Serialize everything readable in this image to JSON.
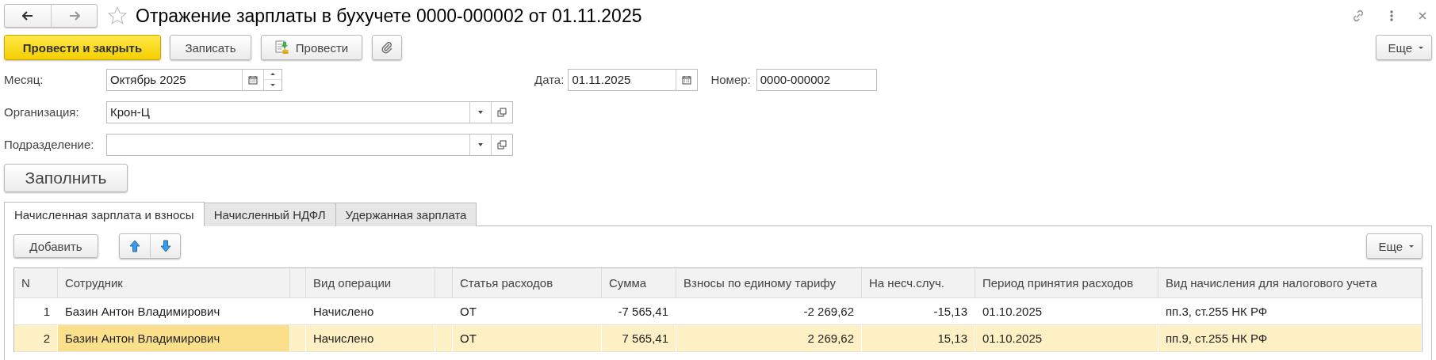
{
  "window": {
    "title": "Отражение зарплаты в бухучете 0000-000002 от 01.11.2025",
    "favorite": false
  },
  "command_bar": {
    "buttons": [
      {
        "label": "Провести и закрыть",
        "kind": "primary"
      },
      {
        "label": "Записать",
        "kind": "plain"
      },
      {
        "label": "Провести",
        "kind": "post"
      },
      {
        "kind": "attach"
      }
    ],
    "more": "Еще"
  },
  "fields": {
    "month": {
      "label": "Месяц:",
      "value": "Октябрь 2025"
    },
    "date": {
      "label": "Дата:",
      "value": "01.11.2025"
    },
    "number": {
      "label": "Номер:",
      "value": "0000-000002"
    },
    "organization": {
      "label": "Организация:",
      "value": "Крон-Ц"
    },
    "division": {
      "label": "Подразделение:"
    }
  },
  "fill_button": "Заполнить",
  "tabs": [
    {
      "label": "Начисленная зарплата и взносы",
      "selected": true
    },
    {
      "label": "Начисленный НДФЛ",
      "selected": false
    },
    {
      "label": "Удержанная зарплата",
      "selected": false
    }
  ],
  "table_toolbar": {
    "add": "Добавить",
    "more": "Еще"
  },
  "table": {
    "columns": [
      "N",
      "Сотрудник",
      "Вид операции",
      "Статья расходов",
      "Сумма",
      "Взносы по единому тарифу",
      "На несч.случ.",
      "Период принятия расходов",
      "Вид начисления для налогового учета"
    ],
    "rows": [
      {
        "cells": [
          "1",
          "Базин Антон Владимирович",
          "Начислено",
          "ОТ",
          "-7 565,41",
          "-2 269,62",
          "-15,13",
          "01.10.2025",
          "пп.3, ст.255 НК РФ"
        ],
        "selected": false,
        "focused": false
      },
      {
        "cells": [
          "2",
          "Базин Антон Владимирович",
          "Начислено",
          "ОТ",
          "7 565,41",
          "2 269,62",
          "15,13",
          "01.10.2025",
          "пп.9, ст.255 НК РФ"
        ],
        "selected": true,
        "focused": true
      }
    ]
  }
}
